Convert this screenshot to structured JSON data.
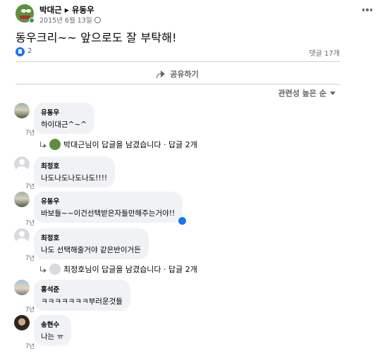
{
  "post": {
    "author": "박대근",
    "target": "유동우",
    "date": "2015년 6월 13일",
    "text": "동우크리~~ 앞으로도 잘 부탁해!",
    "like_count": "2",
    "comment_count": "댓글 17개",
    "share_label": "공유하기"
  },
  "sort": {
    "label": "관련성 높은 순"
  },
  "comments": [
    {
      "name": "유동우",
      "text": "하이대근^~^",
      "time": "7년"
    },
    {
      "name": "최정호",
      "text": "나도나도나도나도!!!!",
      "time": "7년"
    },
    {
      "name": "유동우",
      "text": "바보들~~이건선택받은자들만해주는거야!!",
      "time": "7년"
    },
    {
      "name": "최정호",
      "text": "나도 선택해줄거야 같은반이거든",
      "time": "7년"
    },
    {
      "name": "홍석준",
      "text": "ㅋㅋㅋㅋㅋㅋㅋ부러운것들",
      "time": "7년"
    },
    {
      "name": "송현수",
      "text": "나는 ㅠ",
      "time": "7년"
    }
  ],
  "replies": [
    {
      "text": "박대근님이 답글을 남겼습니다 · 답글 2개"
    },
    {
      "text": "최정호님이 답글을 남겼습니다 · 답글 2개"
    }
  ],
  "colors": {
    "accent": "#1877f2",
    "online": "#31a24c",
    "bubble": "#f0f2f5",
    "muted": "#65676b"
  },
  "icons": [
    "globe-icon",
    "more-icon",
    "like-icon",
    "share-icon",
    "sort-caret-icon",
    "reply-arrow-icon"
  ]
}
